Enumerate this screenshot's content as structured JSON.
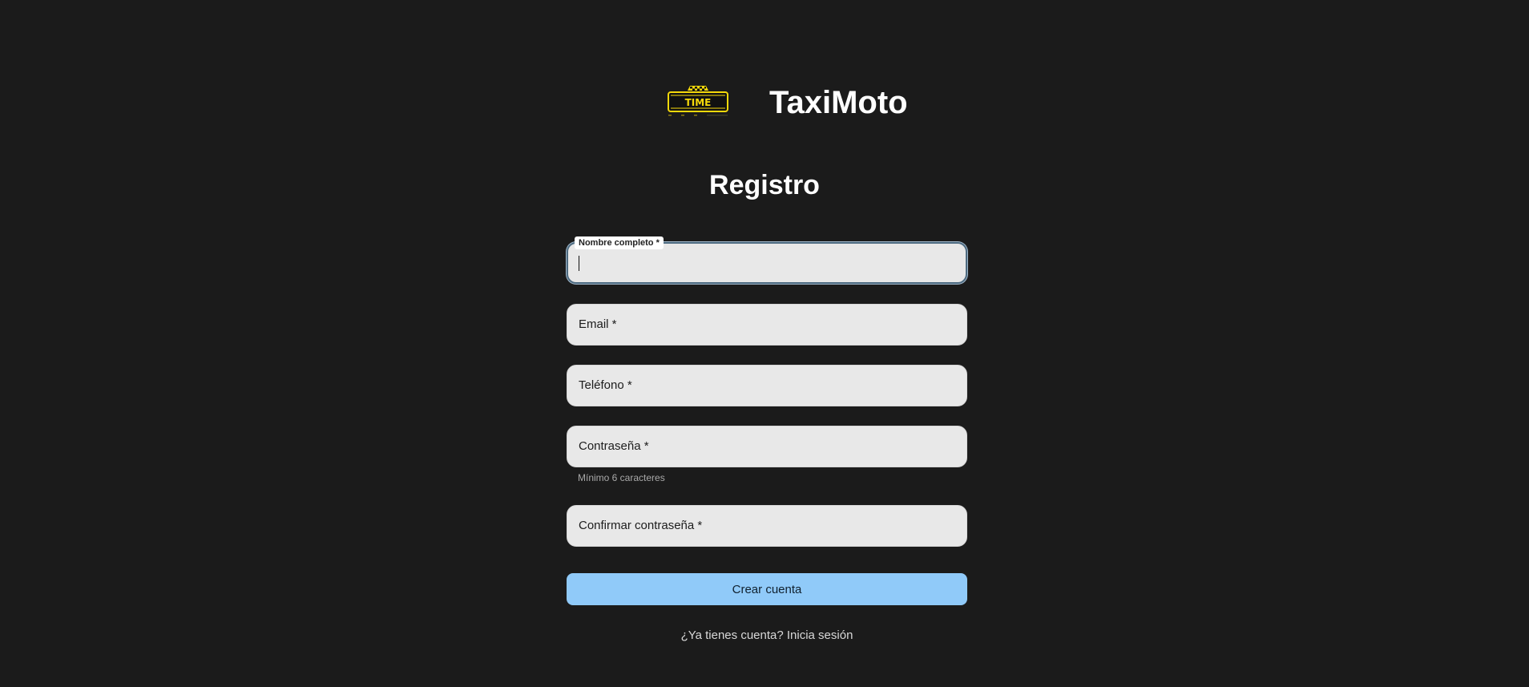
{
  "brand": {
    "name": "TaxiMoto",
    "logo_text": "TIME",
    "logo_color": "#f5d90a"
  },
  "page": {
    "title": "Registro"
  },
  "form": {
    "full_name": {
      "label": "Nombre completo *",
      "value": ""
    },
    "email": {
      "label": "Email *",
      "value": ""
    },
    "phone": {
      "label": "Teléfono *",
      "value": ""
    },
    "password": {
      "label": "Contraseña *",
      "helper": "Mínimo 6 caracteres",
      "value": ""
    },
    "confirm_password": {
      "label": "Confirmar contraseña *",
      "value": ""
    },
    "submit_label": "Crear cuenta",
    "login_link": "¿Ya tienes cuenta? Inicia sesión"
  },
  "colors": {
    "background": "#1b1b1b",
    "field_bg": "#e8e8e8",
    "button_bg": "#90caf9"
  }
}
